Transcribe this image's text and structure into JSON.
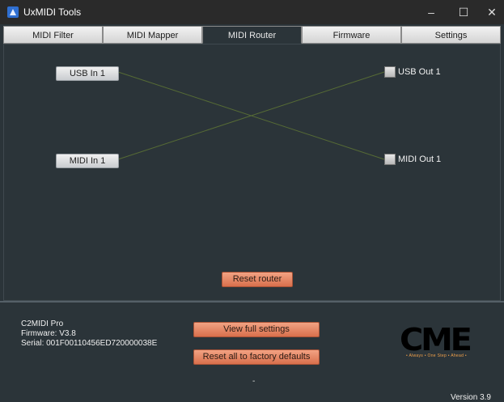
{
  "window": {
    "title": "UxMIDI Tools",
    "minimize": "–",
    "maximize": "☐",
    "close": "✕"
  },
  "tabs": [
    {
      "label": "MIDI Filter"
    },
    {
      "label": "MIDI Mapper"
    },
    {
      "label": "MIDI Router",
      "active": true
    },
    {
      "label": "Firmware"
    },
    {
      "label": "Settings"
    }
  ],
  "router": {
    "inputs": [
      {
        "label": "USB In 1"
      },
      {
        "label": "MIDI In 1"
      }
    ],
    "outputs": [
      {
        "label": "USB Out 1",
        "checked": false
      },
      {
        "label": "MIDI Out 1",
        "checked": false
      }
    ],
    "routes": [
      {
        "from": "USB In 1",
        "to": "MIDI Out 1"
      },
      {
        "from": "MIDI In 1",
        "to": "USB Out 1"
      }
    ],
    "reset_label": "Reset router"
  },
  "device": {
    "name": "C2MIDI Pro",
    "firmware": "Firmware: V3.8",
    "serial": "Serial: 001F00110456ED720000038E"
  },
  "actions": {
    "view_settings": "View full settings",
    "factory_reset": "Reset all to factory defaults"
  },
  "status": "-",
  "logo": {
    "text": "CME",
    "tagline": "• Always • One Step • Ahead •",
    "color_accent": "#f0a04a"
  },
  "version": "Version 3.9",
  "colors": {
    "background": "#2b3439",
    "accent_button": "#e0805d",
    "route_line": "#556b2f"
  }
}
